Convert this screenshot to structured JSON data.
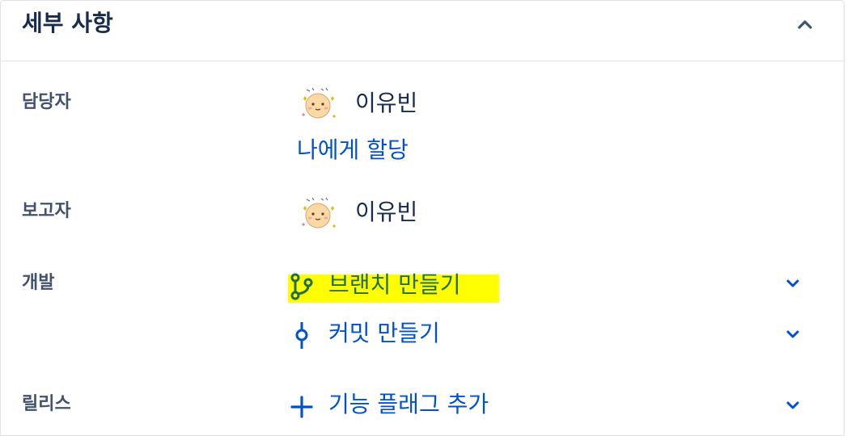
{
  "panel": {
    "title": "세부 사항"
  },
  "fields": {
    "assignee": {
      "label": "담당자",
      "user_name": "이유빈",
      "assign_to_me": "나에게 할당"
    },
    "reporter": {
      "label": "보고자",
      "user_name": "이유빈"
    },
    "development": {
      "label": "개발",
      "create_branch": "브랜치 만들기",
      "create_commit": "커밋 만들기"
    },
    "release": {
      "label": "릴리스",
      "add_feature_flag": "기능 플래그 추가"
    }
  },
  "icons": {
    "collapse": "chevron-up-icon",
    "expand": "chevron-down-icon",
    "branch": "branch-icon",
    "commit": "commit-icon",
    "add": "plus-icon"
  },
  "colors": {
    "link": "#0052cc",
    "branch_icon": "#216e4e",
    "highlight": "#ffff00",
    "label": "#42526e",
    "text": "#172b4d",
    "border": "#dfe1e6"
  }
}
